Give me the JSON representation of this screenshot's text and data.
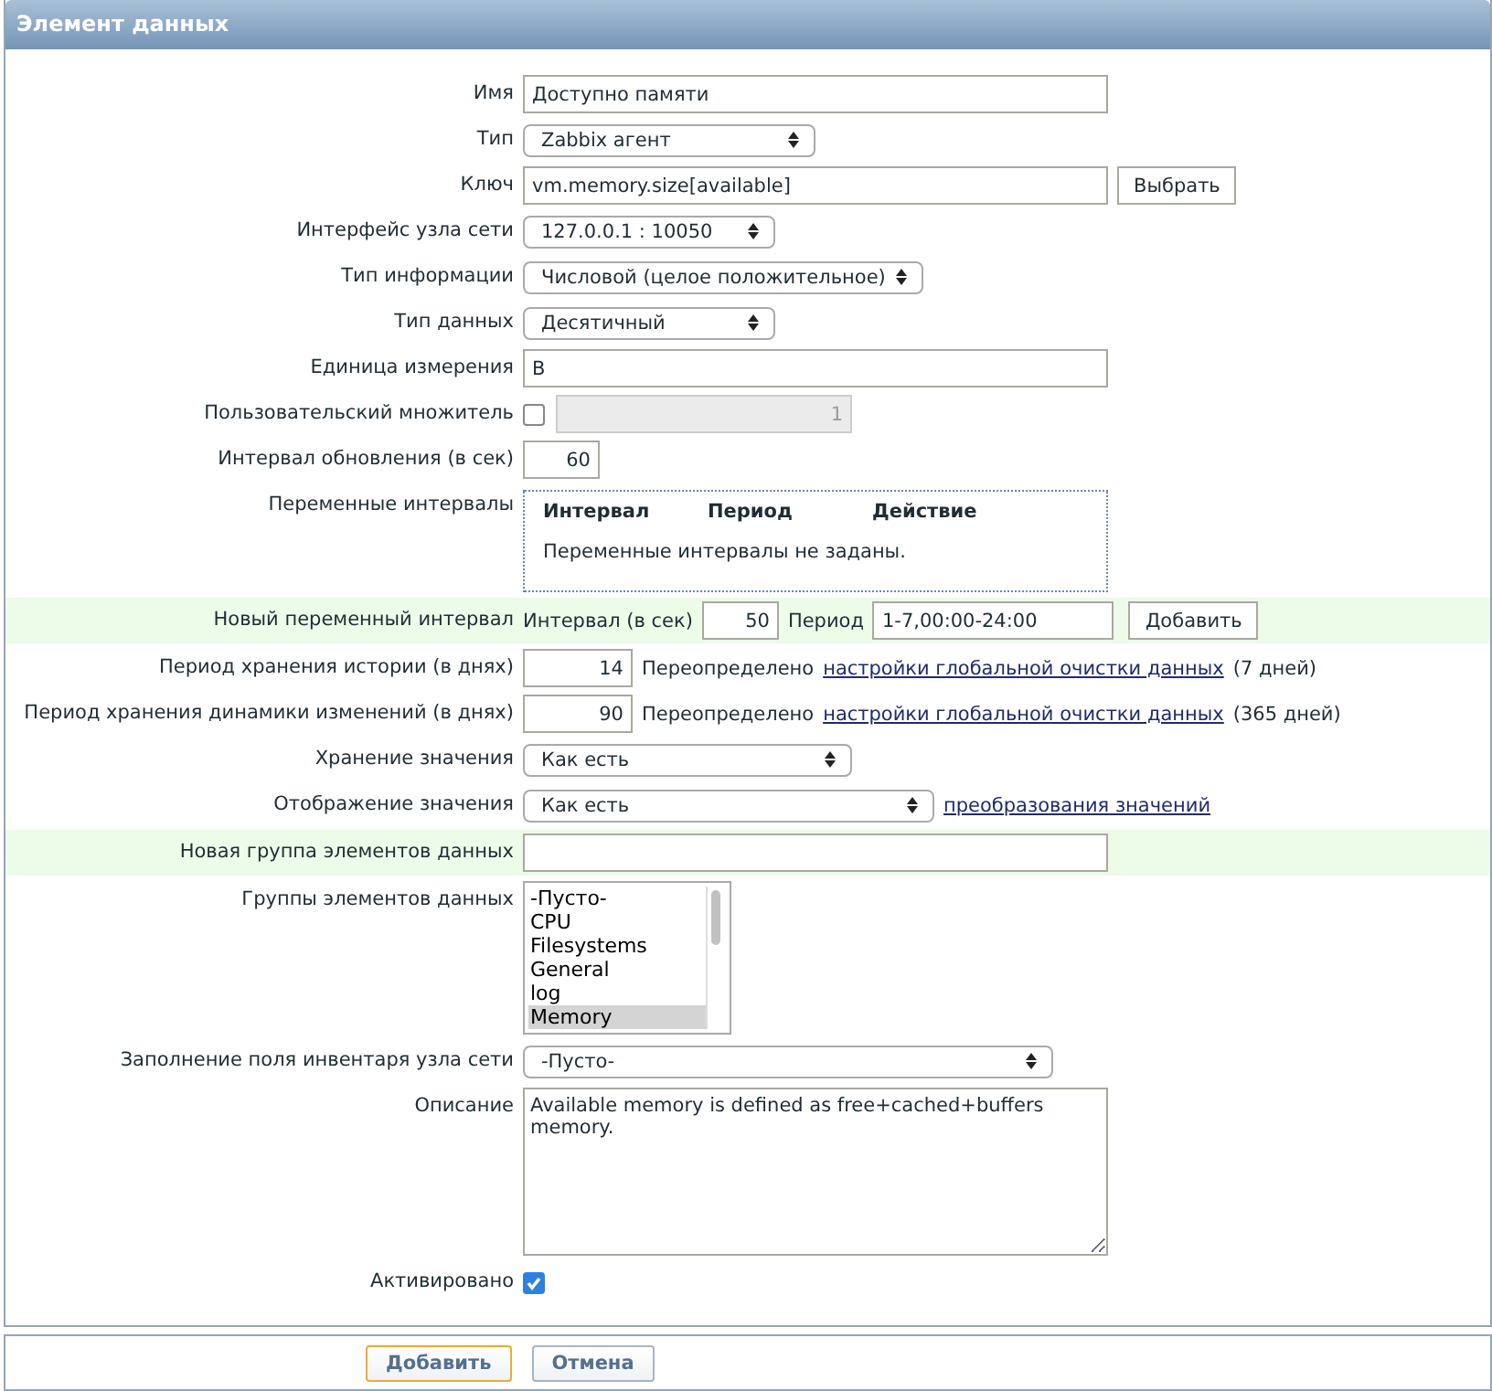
{
  "window": {
    "title": "Элемент данных"
  },
  "form": {
    "rows": [
      {
        "kind": "text",
        "label": "Имя",
        "value": "Доступно памяти"
      },
      {
        "kind": "select",
        "label": "Тип",
        "value": "Zabbix агент"
      },
      {
        "kind": "text_button",
        "label": "Ключ",
        "value": "vm.memory.size[available]",
        "button": "Выбрать"
      },
      {
        "kind": "select",
        "label": "Интерфейс узла сети",
        "value": "127.0.0.1 : 10050"
      },
      {
        "kind": "select",
        "label": "Тип информации",
        "value": "Числовой (целое положительное)"
      },
      {
        "kind": "select",
        "label": "Тип данных",
        "value": "Десятичный"
      },
      {
        "kind": "text",
        "label": "Единица измерения",
        "value": "B"
      },
      {
        "kind": "checkbox_input",
        "label": "Пользовательский множитель",
        "checked": false,
        "value": "1",
        "disabled": true
      },
      {
        "kind": "number",
        "label": "Интервал обновления (в сек)",
        "value": "60"
      },
      {
        "kind": "table",
        "label": "Переменные интервалы",
        "columns": [
          "Интервал",
          "Период",
          "Действие"
        ],
        "empty": "Переменные интервалы не заданы."
      },
      {
        "kind": "interval",
        "label": "Новый переменный интервал",
        "highlighted": true,
        "interval_label": "Интервал (в сек)",
        "interval_value": "50",
        "period_label": "Период",
        "period_value": "1-7,00:00-24:00",
        "button": "Добавить"
      },
      {
        "kind": "retention",
        "label": "Период хранения истории (в днях)",
        "value": "14",
        "note": "Переопределено",
        "link": "настройки глобальной очистки данных",
        "suffix": "(7 дней)"
      },
      {
        "kind": "retention",
        "label": "Период хранения динамики изменений (в днях)",
        "value": "90",
        "note": "Переопределено",
        "link": "настройки глобальной очистки данных",
        "suffix": "(365 дней)"
      },
      {
        "kind": "select",
        "label": "Хранение значения",
        "value": "Как есть"
      },
      {
        "kind": "select_link",
        "label": "Отображение значения",
        "value": "Как есть",
        "link": "преобразования значений"
      },
      {
        "kind": "text",
        "label": "Новая группа элементов данных",
        "highlighted": true
      },
      {
        "kind": "listbox",
        "label": "Группы элементов данных",
        "items": [
          {
            "text": "-Пусто-",
            "selected": false
          },
          {
            "text": "CPU",
            "selected": false
          },
          {
            "text": "Filesystems",
            "selected": false
          },
          {
            "text": "General",
            "selected": false
          },
          {
            "text": "log",
            "selected": false
          },
          {
            "text": "Memory",
            "selected": true
          }
        ]
      },
      {
        "kind": "select",
        "label": "Заполнение поля инвентаря узла сети",
        "value": "-Пусто-"
      },
      {
        "kind": "textarea",
        "label": "Описание",
        "value": "Available memory is defined as free+cached+buffers memory."
      },
      {
        "kind": "checkbox",
        "label": "Активировано",
        "checked": true
      }
    ]
  },
  "footer": {
    "buttons": [
      {
        "label": "Добавить",
        "kind": "primary"
      },
      {
        "label": "Отмена",
        "kind": "secondary"
      }
    ]
  }
}
